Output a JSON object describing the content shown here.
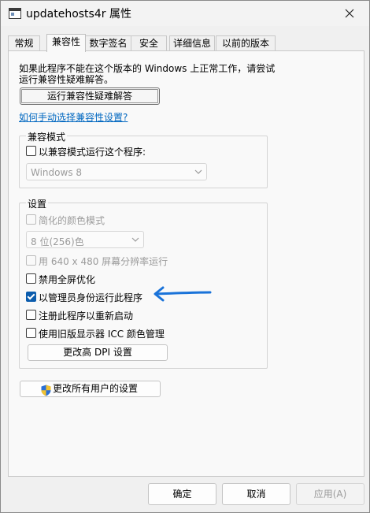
{
  "window": {
    "title": "updatehosts4r 属性"
  },
  "tabs": [
    {
      "label": "常规"
    },
    {
      "label": "兼容性"
    },
    {
      "label": "数字签名"
    },
    {
      "label": "安全"
    },
    {
      "label": "详细信息"
    },
    {
      "label": "以前的版本"
    }
  ],
  "intro": {
    "line1": "如果此程序不能在这个版本的 Windows 上正常工作，请尝试",
    "line2": "运行兼容性疑难解答。"
  },
  "troubleshoot_button": "运行兼容性疑难解答",
  "manual_link": "如何手动选择兼容性设置?",
  "compat_mode": {
    "legend": "兼容模式",
    "checkbox_label": "以兼容模式运行这个程序:",
    "checked": false,
    "select_value": "Windows 8"
  },
  "settings": {
    "legend": "设置",
    "reduced_color_label": "简化的颜色模式",
    "color_select_value": "8 位(256)色",
    "res640_label": "用 640 x 480 屏幕分辨率运行",
    "disable_fullscreen_label": "禁用全屏优化",
    "run_as_admin_label": "以管理员身份运行此程序",
    "run_as_admin_checked": true,
    "register_restart_label": "注册此程序以重新启动",
    "legacy_icc_label": "使用旧版显示器 ICC 颜色管理",
    "high_dpi_button": "更改高 DPI 设置"
  },
  "all_users_button": "更改所有用户的设置",
  "footer": {
    "ok": "确定",
    "cancel": "取消",
    "apply": "应用(A)"
  },
  "colors": {
    "accent": "#0b5cad",
    "annotation_arrow": "#1a73d9",
    "link": "#0067c0"
  }
}
